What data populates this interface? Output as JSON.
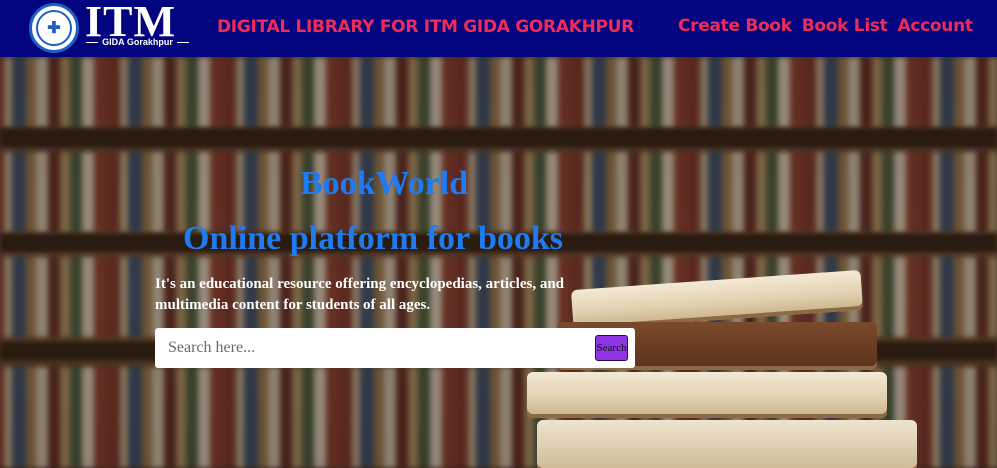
{
  "header": {
    "logo_text": "ITM",
    "logo_subtext": "GIDA Gorakhpur",
    "logo_emblem_icon": "itm-emblem-icon",
    "site_title": "DIGITAL LIBRARY FOR ITM GIDA GORAKHPUR",
    "nav": [
      {
        "label": "Create Book"
      },
      {
        "label": "Book List"
      },
      {
        "label": "Account"
      }
    ]
  },
  "hero": {
    "brand": "BookWorld",
    "tagline": "Online platform for books",
    "description": "It's an educational resource offering encyclopedias, articles, and multimedia content for students of all ages.",
    "search": {
      "placeholder": "Search here...",
      "value": "",
      "button_label": "Search"
    }
  },
  "colors": {
    "navbar_bg": "#02057f",
    "nav_text": "#f02b55",
    "heading_text": "#1e7bf2",
    "search_button_bg": "#8f35e6"
  }
}
